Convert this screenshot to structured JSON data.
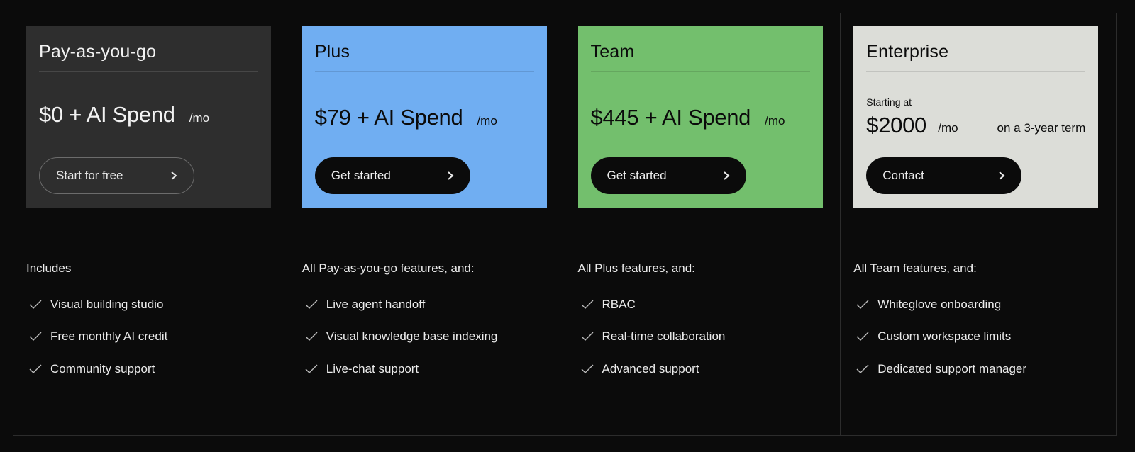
{
  "plans": [
    {
      "name": "Pay-as-you-go",
      "price": "$0 + AI Spend",
      "period": "/mo",
      "button_label": "Start for free",
      "features_heading": "Includes",
      "features": [
        "Visual building studio",
        "Free monthly AI credit",
        "Community support"
      ],
      "card_color": "#2e2e2e"
    },
    {
      "name": "Plus",
      "price": "$79 + AI Spend",
      "period": "/mo",
      "button_label": "Get started",
      "features_heading": "All Pay-as-you-go features, and:",
      "features": [
        "Live agent handoff",
        "Visual knowledge base indexing",
        "Live-chat support"
      ],
      "card_color": "#70aef2"
    },
    {
      "name": "Team",
      "price": "$445 + AI Spend",
      "period": "/mo",
      "button_label": "Get started",
      "features_heading": "All Plus features, and:",
      "features": [
        "RBAC",
        "Real-time collaboration",
        "Advanced support"
      ],
      "card_color": "#73bf6d"
    },
    {
      "name": "Enterprise",
      "starting_label": "Starting at",
      "price": "$2000",
      "period": "/mo",
      "term": "on a 3-year term",
      "button_label": "Contact",
      "features_heading": "All Team features, and:",
      "features": [
        "Whiteglove onboarding",
        "Custom workspace limits",
        "Dedicated support manager"
      ],
      "card_color": "#dcddd8"
    }
  ],
  "icons": {
    "button_arrow": "chevron-right-icon",
    "feature_bullet": "check-icon"
  }
}
